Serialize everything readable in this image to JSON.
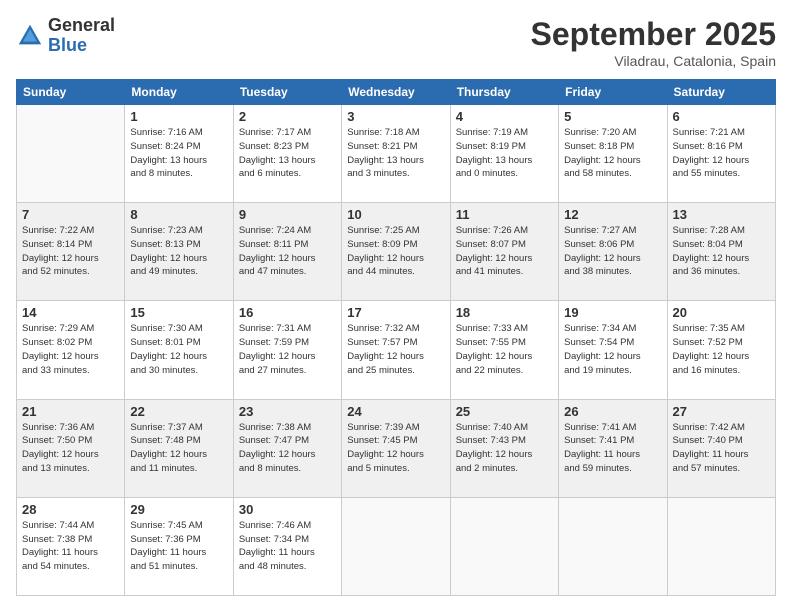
{
  "logo": {
    "general": "General",
    "blue": "Blue"
  },
  "header": {
    "month_year": "September 2025",
    "location": "Viladrau, Catalonia, Spain"
  },
  "weekdays": [
    "Sunday",
    "Monday",
    "Tuesday",
    "Wednesday",
    "Thursday",
    "Friday",
    "Saturday"
  ],
  "weeks": [
    [
      {
        "day": "",
        "info": ""
      },
      {
        "day": "1",
        "info": "Sunrise: 7:16 AM\nSunset: 8:24 PM\nDaylight: 13 hours\nand 8 minutes."
      },
      {
        "day": "2",
        "info": "Sunrise: 7:17 AM\nSunset: 8:23 PM\nDaylight: 13 hours\nand 6 minutes."
      },
      {
        "day": "3",
        "info": "Sunrise: 7:18 AM\nSunset: 8:21 PM\nDaylight: 13 hours\nand 3 minutes."
      },
      {
        "day": "4",
        "info": "Sunrise: 7:19 AM\nSunset: 8:19 PM\nDaylight: 13 hours\nand 0 minutes."
      },
      {
        "day": "5",
        "info": "Sunrise: 7:20 AM\nSunset: 8:18 PM\nDaylight: 12 hours\nand 58 minutes."
      },
      {
        "day": "6",
        "info": "Sunrise: 7:21 AM\nSunset: 8:16 PM\nDaylight: 12 hours\nand 55 minutes."
      }
    ],
    [
      {
        "day": "7",
        "info": "Sunrise: 7:22 AM\nSunset: 8:14 PM\nDaylight: 12 hours\nand 52 minutes."
      },
      {
        "day": "8",
        "info": "Sunrise: 7:23 AM\nSunset: 8:13 PM\nDaylight: 12 hours\nand 49 minutes."
      },
      {
        "day": "9",
        "info": "Sunrise: 7:24 AM\nSunset: 8:11 PM\nDaylight: 12 hours\nand 47 minutes."
      },
      {
        "day": "10",
        "info": "Sunrise: 7:25 AM\nSunset: 8:09 PM\nDaylight: 12 hours\nand 44 minutes."
      },
      {
        "day": "11",
        "info": "Sunrise: 7:26 AM\nSunset: 8:07 PM\nDaylight: 12 hours\nand 41 minutes."
      },
      {
        "day": "12",
        "info": "Sunrise: 7:27 AM\nSunset: 8:06 PM\nDaylight: 12 hours\nand 38 minutes."
      },
      {
        "day": "13",
        "info": "Sunrise: 7:28 AM\nSunset: 8:04 PM\nDaylight: 12 hours\nand 36 minutes."
      }
    ],
    [
      {
        "day": "14",
        "info": "Sunrise: 7:29 AM\nSunset: 8:02 PM\nDaylight: 12 hours\nand 33 minutes."
      },
      {
        "day": "15",
        "info": "Sunrise: 7:30 AM\nSunset: 8:01 PM\nDaylight: 12 hours\nand 30 minutes."
      },
      {
        "day": "16",
        "info": "Sunrise: 7:31 AM\nSunset: 7:59 PM\nDaylight: 12 hours\nand 27 minutes."
      },
      {
        "day": "17",
        "info": "Sunrise: 7:32 AM\nSunset: 7:57 PM\nDaylight: 12 hours\nand 25 minutes."
      },
      {
        "day": "18",
        "info": "Sunrise: 7:33 AM\nSunset: 7:55 PM\nDaylight: 12 hours\nand 22 minutes."
      },
      {
        "day": "19",
        "info": "Sunrise: 7:34 AM\nSunset: 7:54 PM\nDaylight: 12 hours\nand 19 minutes."
      },
      {
        "day": "20",
        "info": "Sunrise: 7:35 AM\nSunset: 7:52 PM\nDaylight: 12 hours\nand 16 minutes."
      }
    ],
    [
      {
        "day": "21",
        "info": "Sunrise: 7:36 AM\nSunset: 7:50 PM\nDaylight: 12 hours\nand 13 minutes."
      },
      {
        "day": "22",
        "info": "Sunrise: 7:37 AM\nSunset: 7:48 PM\nDaylight: 12 hours\nand 11 minutes."
      },
      {
        "day": "23",
        "info": "Sunrise: 7:38 AM\nSunset: 7:47 PM\nDaylight: 12 hours\nand 8 minutes."
      },
      {
        "day": "24",
        "info": "Sunrise: 7:39 AM\nSunset: 7:45 PM\nDaylight: 12 hours\nand 5 minutes."
      },
      {
        "day": "25",
        "info": "Sunrise: 7:40 AM\nSunset: 7:43 PM\nDaylight: 12 hours\nand 2 minutes."
      },
      {
        "day": "26",
        "info": "Sunrise: 7:41 AM\nSunset: 7:41 PM\nDaylight: 11 hours\nand 59 minutes."
      },
      {
        "day": "27",
        "info": "Sunrise: 7:42 AM\nSunset: 7:40 PM\nDaylight: 11 hours\nand 57 minutes."
      }
    ],
    [
      {
        "day": "28",
        "info": "Sunrise: 7:44 AM\nSunset: 7:38 PM\nDaylight: 11 hours\nand 54 minutes."
      },
      {
        "day": "29",
        "info": "Sunrise: 7:45 AM\nSunset: 7:36 PM\nDaylight: 11 hours\nand 51 minutes."
      },
      {
        "day": "30",
        "info": "Sunrise: 7:46 AM\nSunset: 7:34 PM\nDaylight: 11 hours\nand 48 minutes."
      },
      {
        "day": "",
        "info": ""
      },
      {
        "day": "",
        "info": ""
      },
      {
        "day": "",
        "info": ""
      },
      {
        "day": "",
        "info": ""
      }
    ]
  ]
}
